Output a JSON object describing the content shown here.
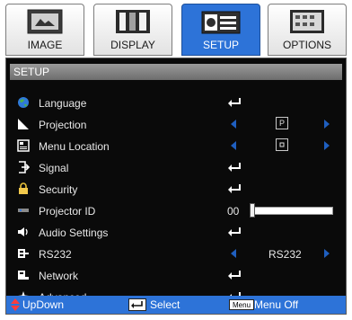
{
  "tabs": [
    {
      "label": "IMAGE",
      "icon": "image-icon",
      "active": false
    },
    {
      "label": "DISPLAY",
      "icon": "display-icon",
      "active": false
    },
    {
      "label": "SETUP",
      "icon": "setup-icon",
      "active": true
    },
    {
      "label": "OPTIONS",
      "icon": "options-icon",
      "active": false
    }
  ],
  "panel": {
    "title": "SETUP",
    "items": [
      {
        "label": "Language",
        "icon": "globe-icon",
        "control": "enter"
      },
      {
        "label": "Projection",
        "icon": "projection-icon",
        "control": "selector",
        "value_symbol": "P"
      },
      {
        "label": "Menu Location",
        "icon": "menu-location-icon",
        "control": "selector",
        "value_symbol": "center-box"
      },
      {
        "label": "Signal",
        "icon": "signal-icon",
        "control": "enter"
      },
      {
        "label": "Security",
        "icon": "lock-icon",
        "control": "enter"
      },
      {
        "label": "Projector ID",
        "icon": "projector-id-icon",
        "control": "slider",
        "value": "00"
      },
      {
        "label": "Audio Settings",
        "icon": "speaker-icon",
        "control": "enter"
      },
      {
        "label": "RS232",
        "icon": "rs232-icon",
        "control": "selector",
        "value": "RS232"
      },
      {
        "label": "Network",
        "icon": "network-icon",
        "control": "enter"
      },
      {
        "label": "Advanced",
        "icon": "advanced-icon",
        "control": "enter"
      }
    ]
  },
  "bottom_bar": {
    "updown_label": "UpDown",
    "select_label": "Select",
    "menu_key_label": "Menu",
    "menu_off_label": "Menu Off"
  },
  "colors": {
    "accent": "#2d73d8",
    "panel_bg": "#0a0a0a",
    "arrow": "#1f5fc0"
  }
}
